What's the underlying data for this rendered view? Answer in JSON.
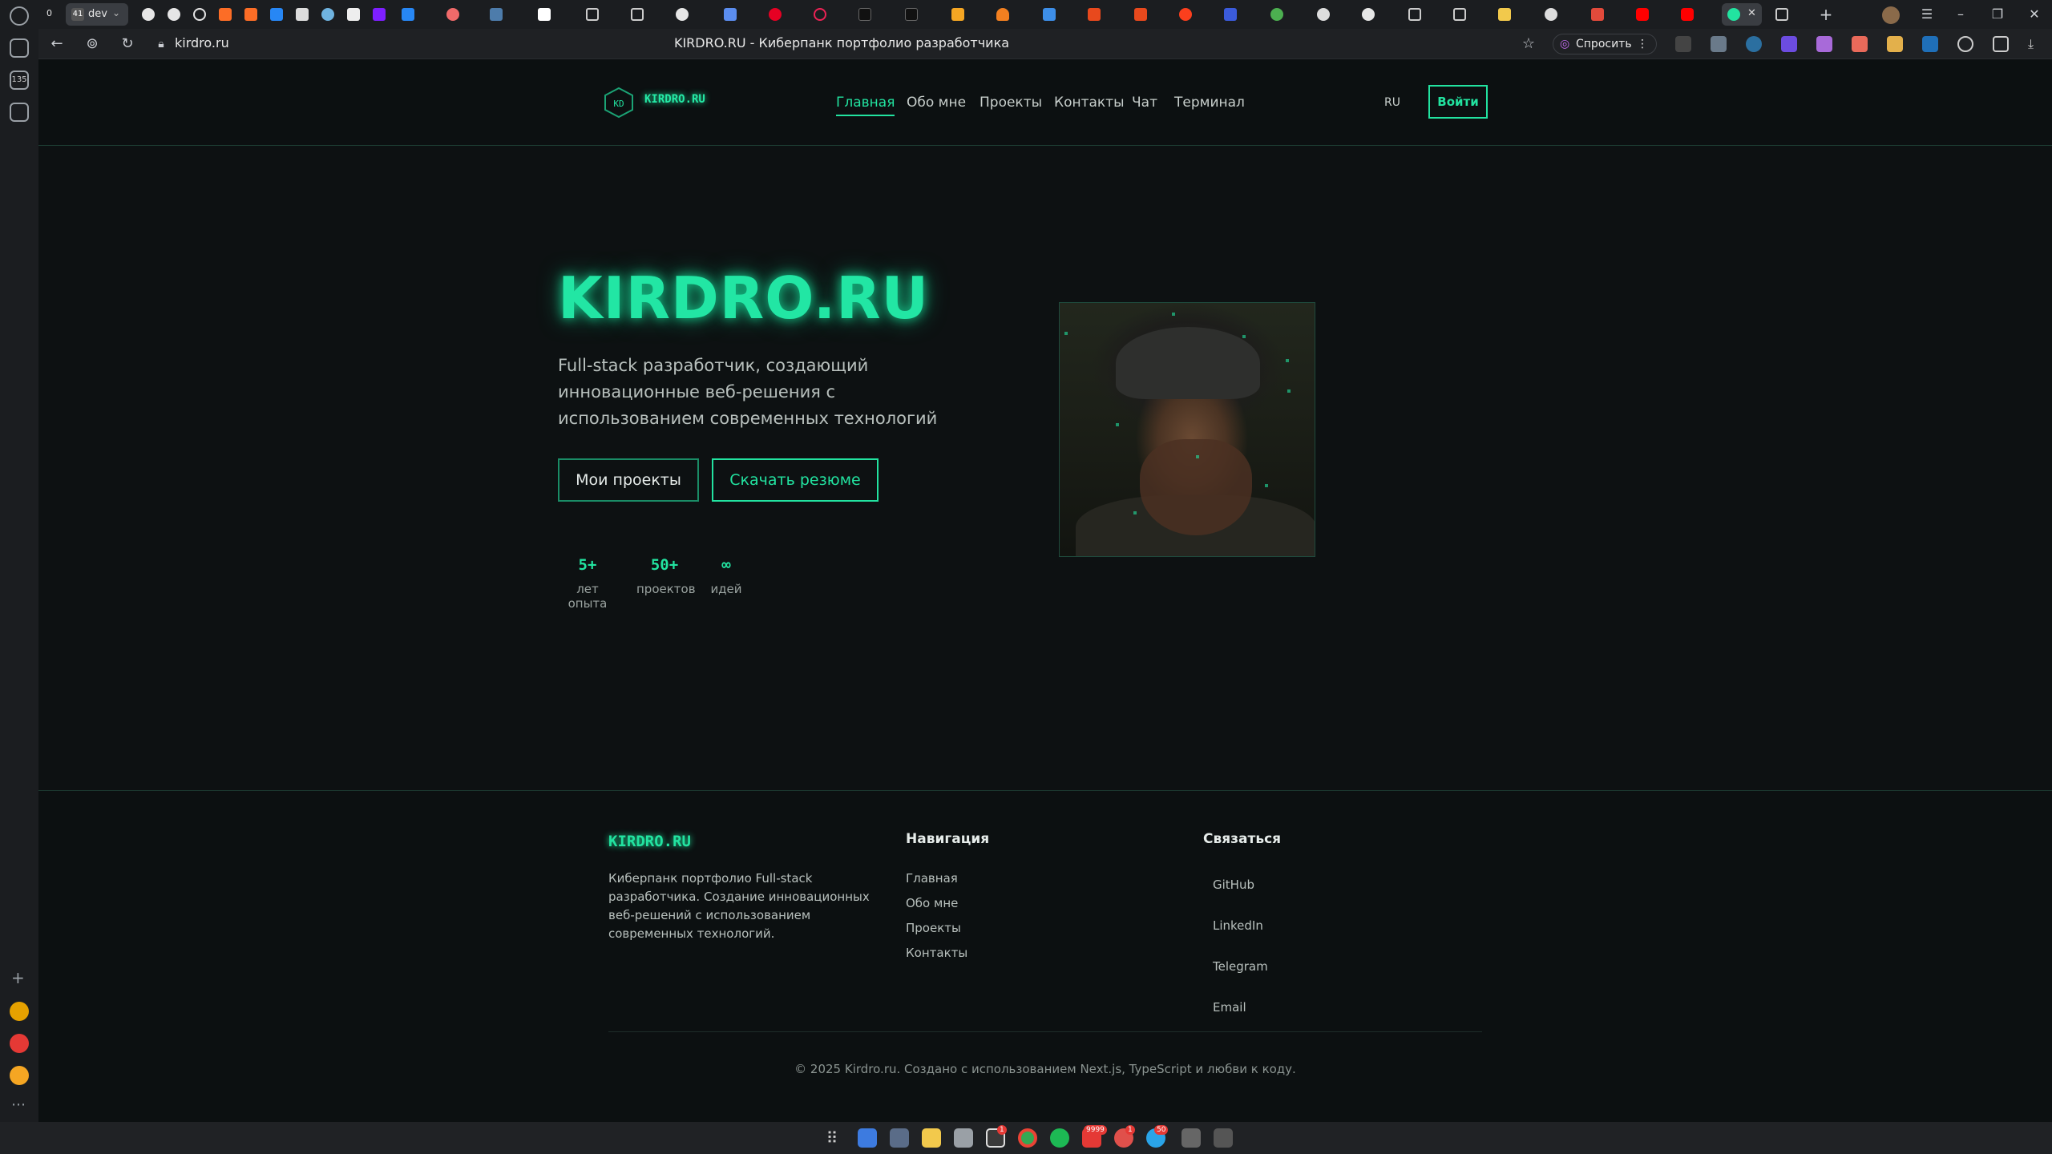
{
  "browser": {
    "url": "kirdro.ru",
    "title": "KIRDRO.RU - Киберпанк портфолио разработчика",
    "ask_label": "Спросить",
    "active_tab_label": "dev",
    "tab_count_label": "41",
    "sidebar_badge": "135"
  },
  "site": {
    "logo": "KIRDRO.RU",
    "logo_icon_text": "KD",
    "nav": [
      "Главная",
      "Обо мне",
      "Проекты",
      "Контакты",
      "Чат",
      "Терминал"
    ],
    "lang": "RU",
    "login": "Войти",
    "hero": {
      "title": "KIRDRO.RU",
      "subtitle": "Full-stack разработчик, создающий инновационные веб-решения с использованием современных технологий",
      "btn_projects": "Мои проекты",
      "btn_resume": "Скачать резюме",
      "stats": [
        {
          "value": "5+",
          "label": "лет опыта"
        },
        {
          "value": "50+",
          "label": "проектов"
        },
        {
          "value": "∞",
          "label": "идей"
        }
      ]
    },
    "footer": {
      "logo": "KIRDRO.RU",
      "description": "Киберпанк портфолио Full-stack разработчика. Создание инновационных веб-решений с использованием современных технологий.",
      "nav_heading": "Навигация",
      "nav_links": [
        "Главная",
        "Обо мне",
        "Проекты",
        "Контакты"
      ],
      "contact_heading": "Связаться",
      "contact_links": [
        "GitHub",
        "LinkedIn",
        "Telegram",
        "Email"
      ],
      "copyright": "© 2025 Kirdro.ru. Создано с использованием Next.js, TypeScript и любви к коду."
    }
  },
  "taskbar": {
    "badges": [
      "1",
      "9999",
      "1",
      "50"
    ]
  },
  "colors": {
    "accent": "#22e3a0",
    "background": "#0d1112"
  }
}
